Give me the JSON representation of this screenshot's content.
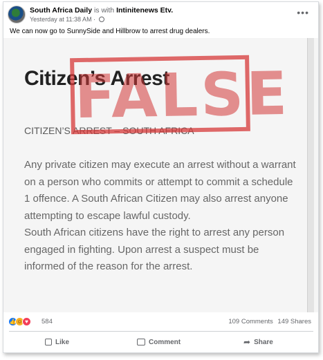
{
  "post": {
    "page_name": "South Africa Daily",
    "with_text": "is with",
    "tagged_page": "Intinitenews Etv.",
    "timestamp": "Yesterday at 11:38 AM ·",
    "more_icon": "more-horizontal-icon",
    "text": "We can now go to SunnySide and Hillbrow to arrest drug dealers."
  },
  "image": {
    "stamp_text": "FALSE",
    "stamp_color": "#d63838",
    "title": "Citizen’s Arrest",
    "subtitle": "CITIZEN’S ARREST – SOUTH AFRICA",
    "paragraph1": "Any private citizen may execute an arrest without a warrant on a person who commits or attempt to commit a schedule 1 offence. A South African Citizen may also arrest anyone attempting to escape lawful custody.",
    "paragraph2": "South African citizens have the right to arrest any person engaged in fighting. Upon arrest a suspect must be informed of the reason for the arrest."
  },
  "stats": {
    "reactions": [
      "like-icon",
      "haha-icon",
      "love-icon"
    ],
    "reaction_count": "584",
    "comments": "109 Comments",
    "shares": "149 Shares"
  },
  "actions": {
    "like": "Like",
    "comment": "Comment",
    "share": "Share"
  }
}
